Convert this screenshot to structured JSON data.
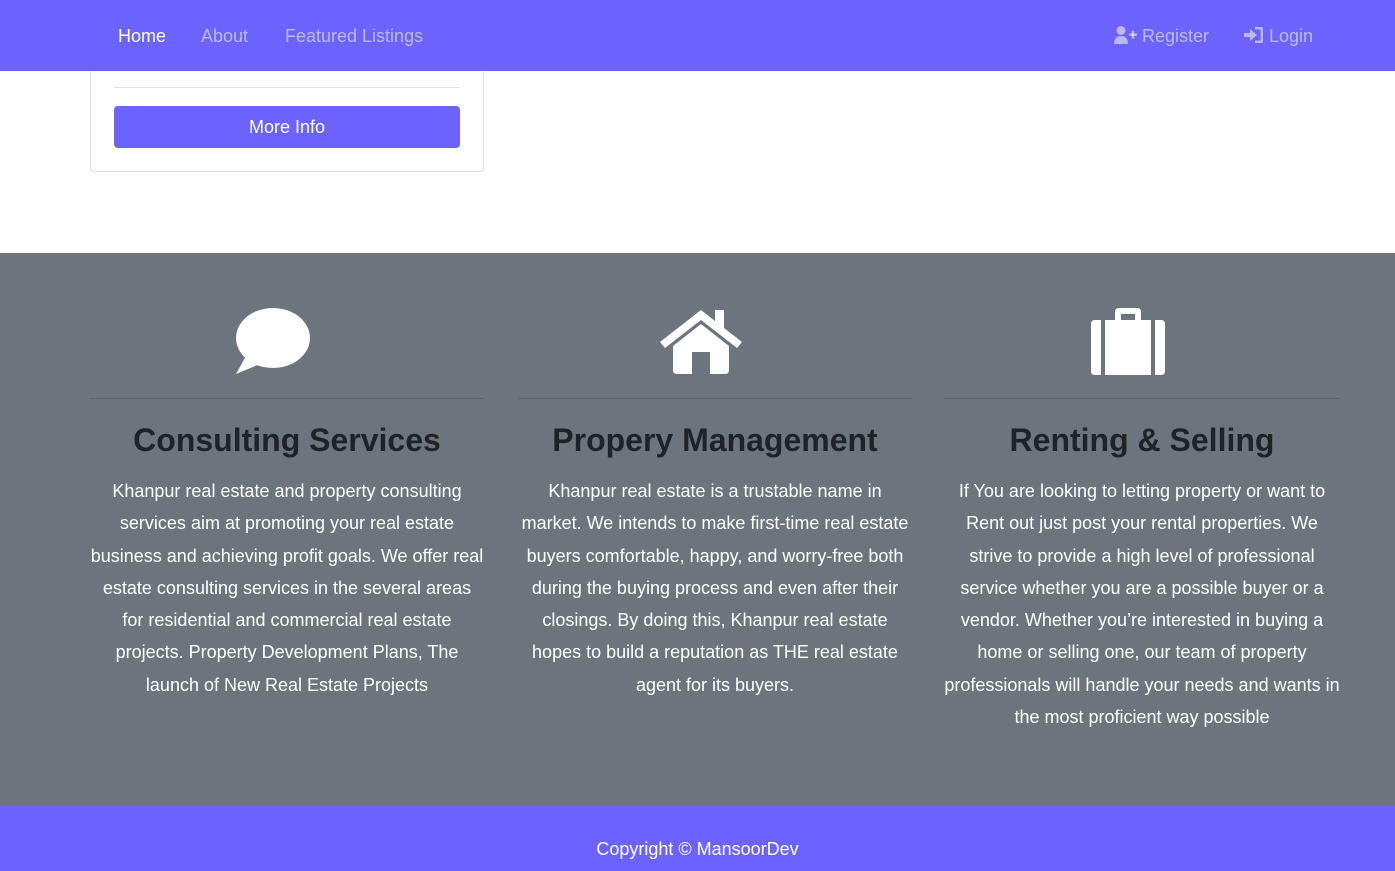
{
  "nav": {
    "home": "Home",
    "about": "About",
    "featured": "Featured Listings",
    "register": "Register",
    "login": "Login",
    "register_icon": "user-plus-icon",
    "login_icon": "sign-in-icon"
  },
  "card": {
    "more_info": "More Info"
  },
  "services": [
    {
      "icon": "comment-icon",
      "title": "Consulting Services",
      "text": "Khanpur real estate and property consulting services aim at promoting your real estate business and achieving profit goals. We offer real estate consulting services in the several areas for residential and commercial real estate projects. Property Development Plans, The launch of New Real Estate Projects"
    },
    {
      "icon": "home-icon",
      "title": "Propery Management",
      "text": "Khanpur real estate is a trustable name in market. We intends to make first-time real estate buyers comfortable, happy, and worry-free both during the buying process and even after their closings. By doing this, Khanpur real estate hopes to build a reputation as THE real estate agent for its buyers."
    },
    {
      "icon": "suitcase-icon",
      "title": "Renting & Selling",
      "text": "If You are looking to letting property or want to Rent out just post your rental properties. We strive to provide a high level of professional service whether you are a possible buyer or a vendor. Whether you’re interested in buying a home or selling one, our team of property professionals will handle your needs and wants in the most proficient way possible"
    }
  ],
  "footer": {
    "copyright": "Copyright © MansoorDev"
  },
  "colors": {
    "brand": "#6c63ff",
    "services_bg": "#6c757d"
  }
}
